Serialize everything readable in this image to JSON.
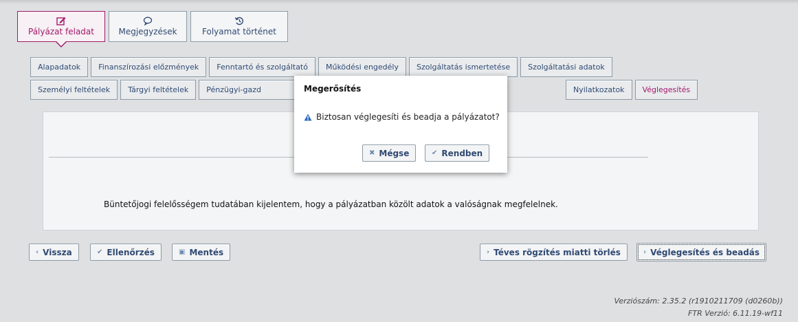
{
  "main_tabs": [
    {
      "label": "Pályázat feladat",
      "icon": "edit-icon",
      "active": true
    },
    {
      "label": "Megjegyzések",
      "icon": "comment-icon",
      "active": false
    },
    {
      "label": "Folyamat történet",
      "icon": "history-icon",
      "active": false
    }
  ],
  "sub_tabs_row1": [
    "Alapadatok",
    "Finanszírozási előzmények",
    "Fenntartó és szolgáltató",
    "Működési engedély",
    "Szolgáltatás ismertetése",
    "Szolgáltatási adatok"
  ],
  "sub_tabs_row2": [
    "Személyi feltételek",
    "Tárgyi feltételek",
    "Pénzügyi-gazd",
    "Nyilatkozatok",
    "Véglegesítés"
  ],
  "panel": {
    "statement": "Büntetőjogi felelősségem tudatában kijelentem, hogy a pályázatban közölt adatok a valóságnak megfelelnek."
  },
  "buttons": {
    "back": "Vissza",
    "check": "Ellenőrzés",
    "save": "Mentés",
    "delete": "Téves rögzítés miatti törlés",
    "finalize": "Véglegesítés és beadás"
  },
  "dialog": {
    "title": "Megerősítés",
    "message": "Biztosan véglegesíti és beadja a pályázatot?",
    "cancel": "Mégse",
    "ok": "Rendben"
  },
  "version": {
    "line1": "Verziószám: 2.35.2 (r1910211709 (d0260b))",
    "line2": "FTR Verzió: 6.11.19-wf11"
  },
  "colors": {
    "accent": "#a2196a",
    "link": "#304a73",
    "background": "#dfe0e2"
  }
}
